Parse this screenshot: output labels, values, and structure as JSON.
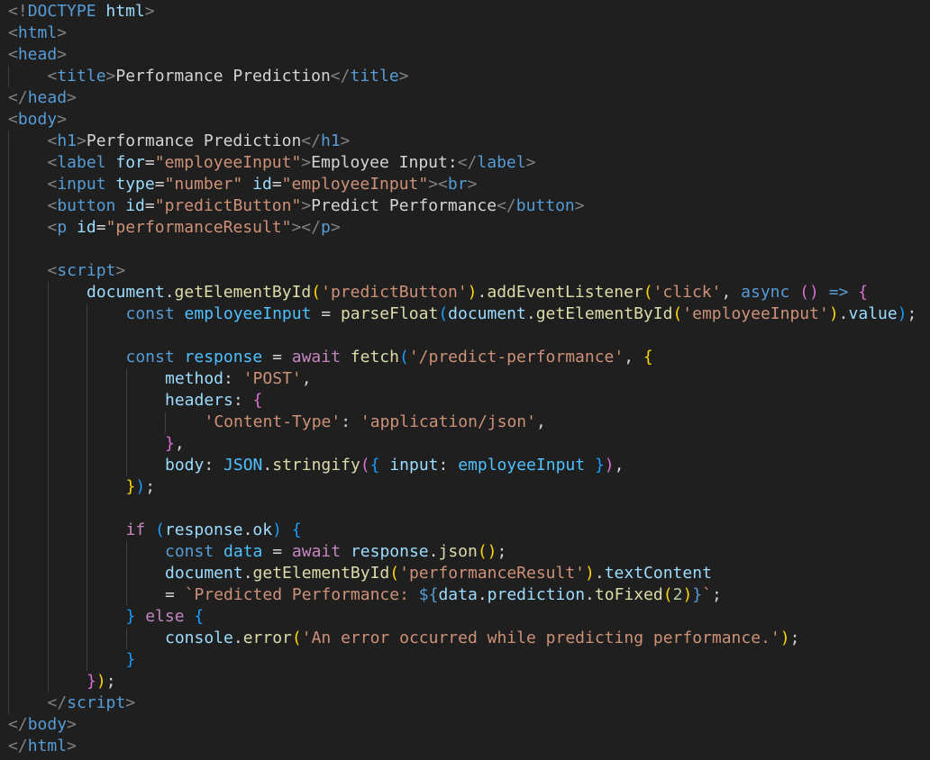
{
  "editor": {
    "theme_colors": {
      "background": "#1f1f1f",
      "tag": "#569cd6",
      "attribute": "#9cdcfe",
      "string": "#ce9178",
      "function": "#dcdcaa",
      "control_keyword": "#c586c0",
      "constant": "#4fc1ff",
      "number": "#b5cea8",
      "bracket_level_1": "#ffd700",
      "bracket_level_2": "#da70d6",
      "bracket_level_3": "#179fff"
    },
    "lines": [
      {
        "indent": 0,
        "tokens": [
          [
            "punct",
            "<!"
          ],
          [
            "tag",
            "DOCTYPE"
          ],
          [
            "plain",
            " "
          ],
          [
            "attr",
            "html"
          ],
          [
            "punct",
            ">"
          ]
        ]
      },
      {
        "indent": 0,
        "tokens": [
          [
            "punct",
            "<"
          ],
          [
            "tag",
            "html"
          ],
          [
            "punct",
            ">"
          ]
        ]
      },
      {
        "indent": 0,
        "tokens": [
          [
            "punct",
            "<"
          ],
          [
            "tag",
            "head"
          ],
          [
            "punct",
            ">"
          ]
        ]
      },
      {
        "indent": 1,
        "tokens": [
          [
            "punct",
            "<"
          ],
          [
            "tag",
            "title"
          ],
          [
            "punct",
            ">"
          ],
          [
            "plain",
            "Performance Prediction"
          ],
          [
            "punct",
            "</"
          ],
          [
            "tag",
            "title"
          ],
          [
            "punct",
            ">"
          ]
        ]
      },
      {
        "indent": 0,
        "tokens": [
          [
            "punct",
            "</"
          ],
          [
            "tag",
            "head"
          ],
          [
            "punct",
            ">"
          ]
        ]
      },
      {
        "indent": 0,
        "tokens": [
          [
            "punct",
            "<"
          ],
          [
            "tag",
            "body"
          ],
          [
            "punct",
            ">"
          ]
        ]
      },
      {
        "indent": 1,
        "tokens": [
          [
            "punct",
            "<"
          ],
          [
            "tag",
            "h1"
          ],
          [
            "punct",
            ">"
          ],
          [
            "plain",
            "Performance Prediction"
          ],
          [
            "punct",
            "</"
          ],
          [
            "tag",
            "h1"
          ],
          [
            "punct",
            ">"
          ]
        ]
      },
      {
        "indent": 1,
        "tokens": [
          [
            "punct",
            "<"
          ],
          [
            "tag",
            "label"
          ],
          [
            "plain",
            " "
          ],
          [
            "attr",
            "for"
          ],
          [
            "plain",
            "="
          ],
          [
            "str",
            "\"employeeInput\""
          ],
          [
            "punct",
            ">"
          ],
          [
            "plain",
            "Employee Input:"
          ],
          [
            "punct",
            "</"
          ],
          [
            "tag",
            "label"
          ],
          [
            "punct",
            ">"
          ]
        ]
      },
      {
        "indent": 1,
        "tokens": [
          [
            "punct",
            "<"
          ],
          [
            "tag",
            "input"
          ],
          [
            "plain",
            " "
          ],
          [
            "attr",
            "type"
          ],
          [
            "plain",
            "="
          ],
          [
            "str",
            "\"number\""
          ],
          [
            "plain",
            " "
          ],
          [
            "attr",
            "id"
          ],
          [
            "plain",
            "="
          ],
          [
            "str",
            "\"employeeInput\""
          ],
          [
            "punct",
            "><"
          ],
          [
            "tag",
            "br"
          ],
          [
            "punct",
            ">"
          ]
        ]
      },
      {
        "indent": 1,
        "tokens": [
          [
            "punct",
            "<"
          ],
          [
            "tag",
            "button"
          ],
          [
            "plain",
            " "
          ],
          [
            "attr",
            "id"
          ],
          [
            "plain",
            "="
          ],
          [
            "str",
            "\"predictButton\""
          ],
          [
            "punct",
            ">"
          ],
          [
            "plain",
            "Predict Performance"
          ],
          [
            "punct",
            "</"
          ],
          [
            "tag",
            "button"
          ],
          [
            "punct",
            ">"
          ]
        ]
      },
      {
        "indent": 1,
        "tokens": [
          [
            "punct",
            "<"
          ],
          [
            "tag",
            "p"
          ],
          [
            "plain",
            " "
          ],
          [
            "attr",
            "id"
          ],
          [
            "plain",
            "="
          ],
          [
            "str",
            "\"performanceResult\""
          ],
          [
            "punct",
            "></"
          ],
          [
            "tag",
            "p"
          ],
          [
            "punct",
            ">"
          ]
        ]
      },
      {
        "indent": 1,
        "tokens": []
      },
      {
        "indent": 1,
        "tokens": [
          [
            "punct",
            "<"
          ],
          [
            "tag",
            "script"
          ],
          [
            "punct",
            ">"
          ]
        ]
      },
      {
        "indent": 2,
        "tokens": [
          [
            "var",
            "document"
          ],
          [
            "plain",
            "."
          ],
          [
            "func",
            "getElementById"
          ],
          [
            "b1",
            "("
          ],
          [
            "str",
            "'predictButton'"
          ],
          [
            "b1",
            ")"
          ],
          [
            "plain",
            "."
          ],
          [
            "func",
            "addEventListener"
          ],
          [
            "b1",
            "("
          ],
          [
            "str",
            "'click'"
          ],
          [
            "plain",
            ", "
          ],
          [
            "kw",
            "async"
          ],
          [
            "plain",
            " "
          ],
          [
            "b2",
            "()"
          ],
          [
            "plain",
            " "
          ],
          [
            "kw",
            "=>"
          ],
          [
            "plain",
            " "
          ],
          [
            "b2",
            "{"
          ]
        ]
      },
      {
        "indent": 3,
        "tokens": [
          [
            "kw",
            "const"
          ],
          [
            "plain",
            " "
          ],
          [
            "cst",
            "employeeInput"
          ],
          [
            "plain",
            " = "
          ],
          [
            "func",
            "parseFloat"
          ],
          [
            "b3",
            "("
          ],
          [
            "var",
            "document"
          ],
          [
            "plain",
            "."
          ],
          [
            "func",
            "getElementById"
          ],
          [
            "b1",
            "("
          ],
          [
            "str",
            "'employeeInput'"
          ],
          [
            "b1",
            ")"
          ],
          [
            "plain",
            "."
          ],
          [
            "var",
            "value"
          ],
          [
            "b3",
            ")"
          ],
          [
            "plain",
            ";"
          ]
        ]
      },
      {
        "indent": 3,
        "tokens": []
      },
      {
        "indent": 3,
        "tokens": [
          [
            "kw",
            "const"
          ],
          [
            "plain",
            " "
          ],
          [
            "cst",
            "response"
          ],
          [
            "plain",
            " = "
          ],
          [
            "ctrl",
            "await"
          ],
          [
            "plain",
            " "
          ],
          [
            "func",
            "fetch"
          ],
          [
            "b3",
            "("
          ],
          [
            "str",
            "'/predict-performance'"
          ],
          [
            "plain",
            ", "
          ],
          [
            "b1",
            "{"
          ]
        ]
      },
      {
        "indent": 4,
        "tokens": [
          [
            "var",
            "method"
          ],
          [
            "plain",
            ": "
          ],
          [
            "str",
            "'POST'"
          ],
          [
            "plain",
            ","
          ]
        ]
      },
      {
        "indent": 4,
        "tokens": [
          [
            "var",
            "headers"
          ],
          [
            "plain",
            ": "
          ],
          [
            "b2",
            "{"
          ]
        ]
      },
      {
        "indent": 5,
        "tokens": [
          [
            "str",
            "'Content-Type'"
          ],
          [
            "plain",
            ": "
          ],
          [
            "str",
            "'application/json'"
          ],
          [
            "plain",
            ","
          ]
        ]
      },
      {
        "indent": 4,
        "tokens": [
          [
            "b2",
            "}"
          ],
          [
            "plain",
            ","
          ]
        ]
      },
      {
        "indent": 4,
        "tokens": [
          [
            "var",
            "body"
          ],
          [
            "plain",
            ": "
          ],
          [
            "cst",
            "JSON"
          ],
          [
            "plain",
            "."
          ],
          [
            "func",
            "stringify"
          ],
          [
            "b2",
            "("
          ],
          [
            "b3",
            "{"
          ],
          [
            "plain",
            " "
          ],
          [
            "var",
            "input"
          ],
          [
            "plain",
            ": "
          ],
          [
            "cst",
            "employeeInput"
          ],
          [
            "plain",
            " "
          ],
          [
            "b3",
            "}"
          ],
          [
            "b2",
            ")"
          ],
          [
            "plain",
            ","
          ]
        ]
      },
      {
        "indent": 3,
        "tokens": [
          [
            "b1",
            "}"
          ],
          [
            "b3",
            ")"
          ],
          [
            "plain",
            ";"
          ]
        ]
      },
      {
        "indent": 3,
        "tokens": []
      },
      {
        "indent": 3,
        "tokens": [
          [
            "ctrl",
            "if"
          ],
          [
            "plain",
            " "
          ],
          [
            "b3",
            "("
          ],
          [
            "var",
            "response"
          ],
          [
            "plain",
            "."
          ],
          [
            "var",
            "ok"
          ],
          [
            "b3",
            ")"
          ],
          [
            "plain",
            " "
          ],
          [
            "b3",
            "{"
          ]
        ]
      },
      {
        "indent": 4,
        "tokens": [
          [
            "kw",
            "const"
          ],
          [
            "plain",
            " "
          ],
          [
            "cst",
            "data"
          ],
          [
            "plain",
            " = "
          ],
          [
            "ctrl",
            "await"
          ],
          [
            "plain",
            " "
          ],
          [
            "var",
            "response"
          ],
          [
            "plain",
            "."
          ],
          [
            "func",
            "json"
          ],
          [
            "b1",
            "()"
          ],
          [
            "plain",
            ";"
          ]
        ]
      },
      {
        "indent": 4,
        "tokens": [
          [
            "var",
            "document"
          ],
          [
            "plain",
            "."
          ],
          [
            "func",
            "getElementById"
          ],
          [
            "b1",
            "("
          ],
          [
            "str",
            "'performanceResult'"
          ],
          [
            "b1",
            ")"
          ],
          [
            "plain",
            "."
          ],
          [
            "var",
            "textContent"
          ]
        ]
      },
      {
        "indent": 4,
        "tokens": [
          [
            "plain",
            "= "
          ],
          [
            "str",
            "`Predicted Performance: "
          ],
          [
            "kw",
            "${"
          ],
          [
            "var",
            "data"
          ],
          [
            "plain",
            "."
          ],
          [
            "var",
            "prediction"
          ],
          [
            "plain",
            "."
          ],
          [
            "func",
            "toFixed"
          ],
          [
            "b1",
            "("
          ],
          [
            "num",
            "2"
          ],
          [
            "b1",
            ")"
          ],
          [
            "kw",
            "}"
          ],
          [
            "str",
            "`"
          ],
          [
            "plain",
            ";"
          ]
        ]
      },
      {
        "indent": 3,
        "tokens": [
          [
            "b3",
            "}"
          ],
          [
            "plain",
            " "
          ],
          [
            "ctrl",
            "else"
          ],
          [
            "plain",
            " "
          ],
          [
            "b3",
            "{"
          ]
        ]
      },
      {
        "indent": 4,
        "tokens": [
          [
            "var",
            "console"
          ],
          [
            "plain",
            "."
          ],
          [
            "func",
            "error"
          ],
          [
            "b1",
            "("
          ],
          [
            "str",
            "'An error occurred while predicting performance.'"
          ],
          [
            "b1",
            ")"
          ],
          [
            "plain",
            ";"
          ]
        ]
      },
      {
        "indent": 3,
        "tokens": [
          [
            "b3",
            "}"
          ]
        ]
      },
      {
        "indent": 2,
        "tokens": [
          [
            "b2",
            "}"
          ],
          [
            "b1",
            ")"
          ],
          [
            "plain",
            ";"
          ]
        ]
      },
      {
        "indent": 1,
        "tokens": [
          [
            "punct",
            "</"
          ],
          [
            "tag",
            "script"
          ],
          [
            "punct",
            ">"
          ]
        ]
      },
      {
        "indent": 0,
        "tokens": [
          [
            "punct",
            "</"
          ],
          [
            "tag",
            "body"
          ],
          [
            "punct",
            ">"
          ]
        ]
      },
      {
        "indent": 0,
        "tokens": [
          [
            "punct",
            "</"
          ],
          [
            "tag",
            "html"
          ],
          [
            "punct",
            ">"
          ]
        ]
      }
    ]
  }
}
